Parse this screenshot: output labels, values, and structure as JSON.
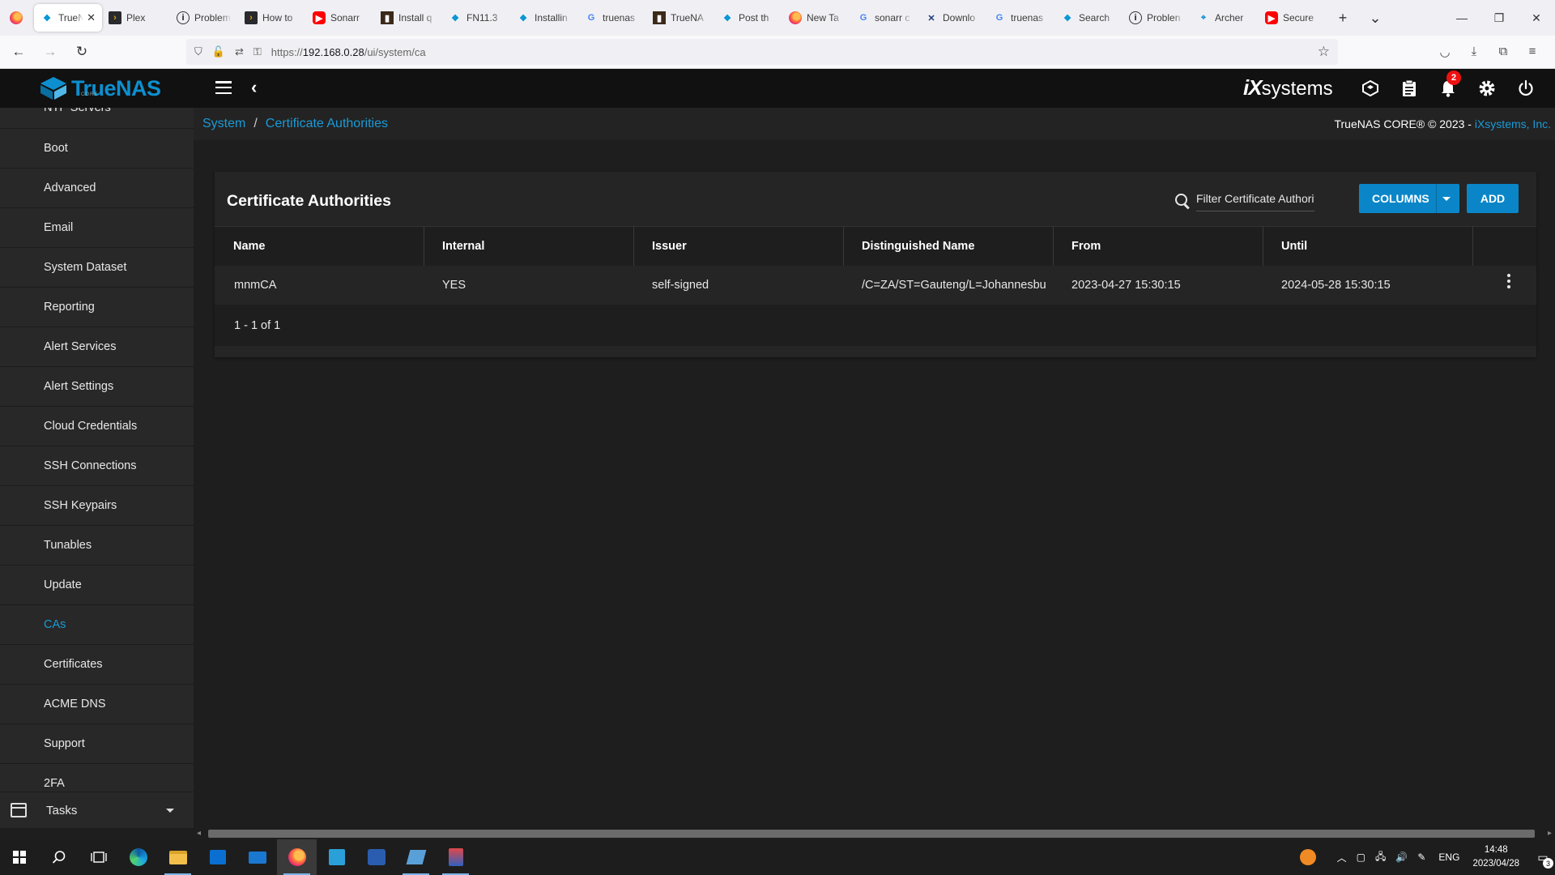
{
  "browser": {
    "tabs": [
      {
        "label": "TrueNAS",
        "icon": "ix-icon",
        "active": true
      },
      {
        "label": "Plex",
        "icon": "plex-icon"
      },
      {
        "label": "Problem",
        "icon": "info-icon"
      },
      {
        "label": "How to",
        "icon": "plex-icon"
      },
      {
        "label": "Sonarr",
        "icon": "youtube-icon"
      },
      {
        "label": "Install q",
        "icon": "book-icon"
      },
      {
        "label": "FN11.3",
        "icon": "ix-icon"
      },
      {
        "label": "Installin",
        "icon": "ix-icon"
      },
      {
        "label": "truenas",
        "icon": "google-icon"
      },
      {
        "label": "TrueNA",
        "icon": "book-icon"
      },
      {
        "label": "Post th",
        "icon": "ix-icon"
      },
      {
        "label": "New Ta",
        "icon": "firefox-icon"
      },
      {
        "label": "sonarr c",
        "icon": "google-icon"
      },
      {
        "label": "Downlo",
        "icon": "x-icon"
      },
      {
        "label": "truenas",
        "icon": "google-icon"
      },
      {
        "label": "Search",
        "icon": "ix-icon"
      },
      {
        "label": "Problen",
        "icon": "info-icon"
      },
      {
        "label": "Archer",
        "icon": "arch-icon"
      },
      {
        "label": "Secure",
        "icon": "youtube-icon"
      }
    ],
    "url_host": "192.168.0.28",
    "url_prefix": "https://",
    "url_path": "/ui/system/ca"
  },
  "topbar": {
    "brand": "TrueNAS",
    "brand_sub": "CORE",
    "vendor_prefix": "iX",
    "vendor_suffix": "systems",
    "notification_count": "2"
  },
  "sidebar": {
    "items": [
      {
        "label": "NTP Servers",
        "partial": true
      },
      {
        "label": "Boot"
      },
      {
        "label": "Advanced"
      },
      {
        "label": "Email"
      },
      {
        "label": "System Dataset"
      },
      {
        "label": "Reporting"
      },
      {
        "label": "Alert Services"
      },
      {
        "label": "Alert Settings"
      },
      {
        "label": "Cloud Credentials"
      },
      {
        "label": "SSH Connections"
      },
      {
        "label": "SSH Keypairs"
      },
      {
        "label": "Tunables"
      },
      {
        "label": "Update"
      },
      {
        "label": "CAs",
        "active": true
      },
      {
        "label": "Certificates"
      },
      {
        "label": "ACME DNS"
      },
      {
        "label": "Support"
      },
      {
        "label": "2FA"
      }
    ],
    "tasks_label": "Tasks"
  },
  "breadcrumb": {
    "parent": "System",
    "separator": "/",
    "current": "Certificate Authorities"
  },
  "copyright": {
    "text": "TrueNAS CORE® © 2023 - ",
    "link": "iXsystems, Inc."
  },
  "card": {
    "title": "Certificate Authorities",
    "filter_placeholder": "Filter Certificate Authorities",
    "columns_label": "COLUMNS",
    "add_label": "ADD",
    "headers": [
      "Name",
      "Internal",
      "Issuer",
      "Distinguished Name",
      "From",
      "Until"
    ],
    "rows": [
      [
        "mnmCA",
        "YES",
        "self-signed",
        "/C=ZA/ST=Gauteng/L=Johannesbu",
        "2023-04-27 15:30:15",
        "2024-05-28 15:30:15"
      ]
    ],
    "pagination": "1 - 1 of 1"
  },
  "taskbar": {
    "language": "ENG",
    "time": "14:48",
    "date": "2023/04/28",
    "notifications": "3"
  }
}
